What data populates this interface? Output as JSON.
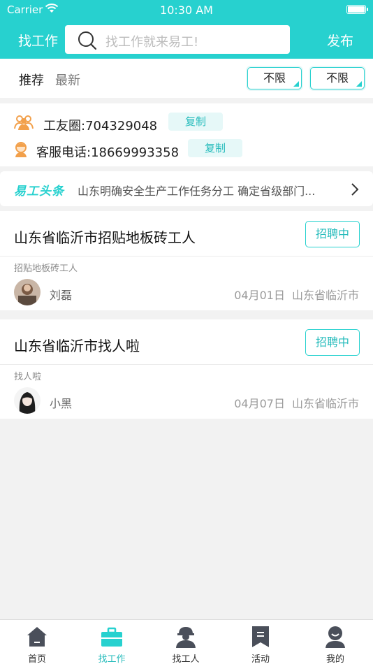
{
  "status_bar": {
    "carrier": "Carrier",
    "time": "10:30 AM"
  },
  "nav": {
    "title": "找工作",
    "search_placeholder": "找工作就来易工!",
    "publish_label": "发布"
  },
  "filters": {
    "tabs": [
      {
        "label": "推荐",
        "active": true
      },
      {
        "label": "最新",
        "active": false
      }
    ],
    "dropdowns": [
      {
        "value": "不限"
      },
      {
        "value": "不限"
      }
    ]
  },
  "contact": {
    "group": {
      "text": "工友圈:704329048",
      "copy_label": "复制",
      "icon": "people-icon"
    },
    "service": {
      "text": "客服电话:18669993358",
      "copy_label": "复制",
      "icon": "support-agent-icon"
    }
  },
  "news": {
    "logo": "易工头条",
    "headline": "山东明确安全生产工作任务分工 确定省级部门...",
    "icon": "chevron-right-icon"
  },
  "jobs": [
    {
      "title": "山东省临沂市招贴地板砖工人",
      "status": "招聘中",
      "subtitle": "招贴地板砖工人",
      "poster": "刘磊",
      "date": "04月01日",
      "location": "山东省临沂市"
    },
    {
      "title": "山东省临沂市找人啦",
      "status": "招聘中",
      "subtitle": "找人啦",
      "poster": "小黑",
      "date": "04月07日",
      "location": "山东省临沂市"
    }
  ],
  "tabbar": {
    "items": [
      {
        "label": "首页",
        "icon": "home-icon",
        "active": false
      },
      {
        "label": "找工作",
        "icon": "briefcase-icon",
        "active": true
      },
      {
        "label": "找工人",
        "icon": "worker-icon",
        "active": false
      },
      {
        "label": "活动",
        "icon": "bookmark-icon",
        "active": false
      },
      {
        "label": "我的",
        "icon": "profile-icon",
        "active": false
      }
    ]
  },
  "colors": {
    "accent": "#27d1cf",
    "background": "#f2f2f2",
    "orange": "#f2a04b"
  }
}
